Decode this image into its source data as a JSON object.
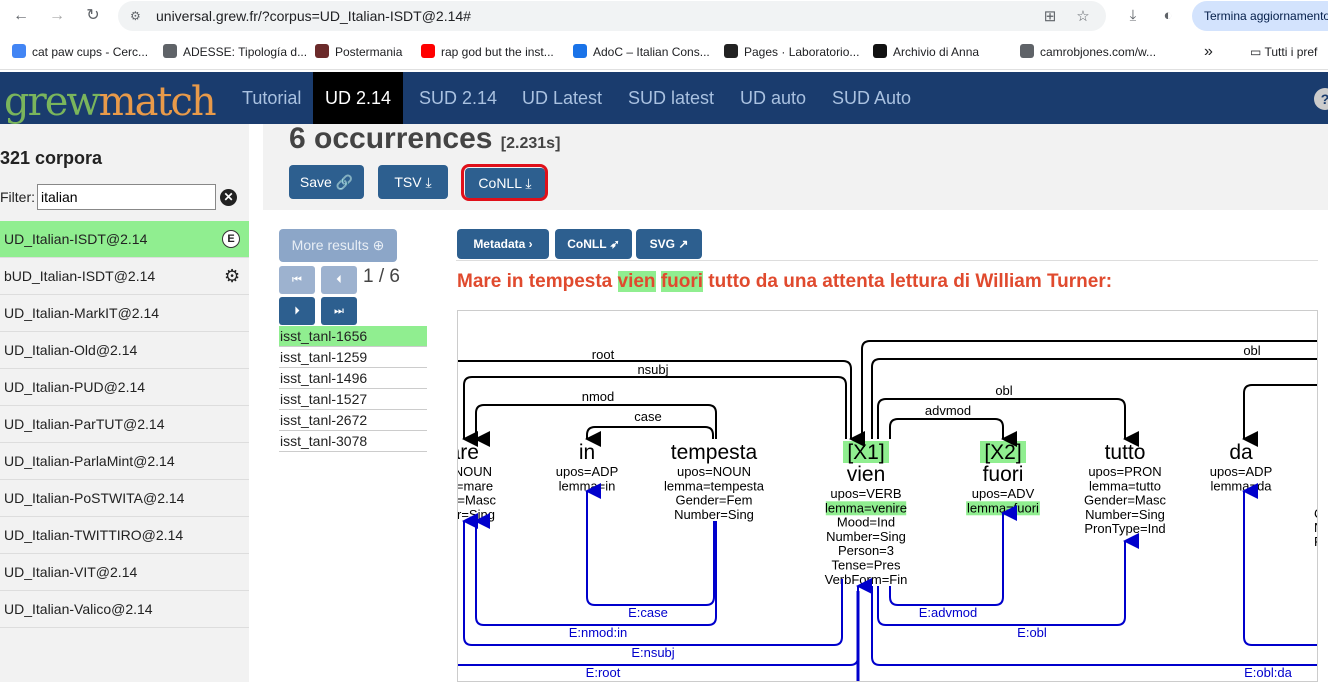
{
  "browser": {
    "url": "universal.grew.fr/?corpus=UD_Italian-ISDT@2.14#",
    "update_button": "Termina aggiornamento",
    "bookmarks": [
      {
        "label": "cat paw cups - Cerc...",
        "icon": "google-icon",
        "color": "#4285f4"
      },
      {
        "label": "ADESSE: Tipología d...",
        "icon": "globe-icon",
        "color": "#5f6368"
      },
      {
        "label": "Postermania",
        "icon": "postermania-icon",
        "color": "#6b2a2a"
      },
      {
        "label": "rap god but the inst...",
        "icon": "youtube-icon",
        "color": "#ff0000"
      },
      {
        "label": "AdoC – Italian Cons...",
        "icon": "cloud-icon",
        "color": "#1a73e8"
      },
      {
        "label": "Pages · Laboratorio...",
        "icon": "github-icon",
        "color": "#222222"
      },
      {
        "label": "Archivio di Anna",
        "icon": "letter-a-icon",
        "color": "#111111"
      },
      {
        "label": "camrobjones.com/w...",
        "icon": "globe-icon",
        "color": "#5f6368"
      }
    ],
    "more_bookmarks": "»",
    "all_bookmarks": "Tutti i pref"
  },
  "app": {
    "logo": {
      "part1": "grew",
      "part2": "match"
    },
    "nav_tabs": [
      "Tutorial",
      "UD 2.14",
      "SUD 2.14",
      "UD Latest",
      "SUD latest",
      "UD auto",
      "SUD Auto"
    ],
    "active_tab": "UD 2.14",
    "help": "?"
  },
  "sidebar": {
    "corpus_count": "321 corpora",
    "filter_label": "Filter:",
    "filter_value": "italian",
    "corpora": [
      {
        "label": "UD_Italian-ISDT@2.14",
        "selected": true,
        "badge": "E"
      },
      {
        "label": "bUD_Italian-ISDT@2.14",
        "gear": true
      },
      {
        "label": "UD_Italian-MarkIT@2.14"
      },
      {
        "label": "UD_Italian-Old@2.14"
      },
      {
        "label": "UD_Italian-PUD@2.14"
      },
      {
        "label": "UD_Italian-ParTUT@2.14"
      },
      {
        "label": "UD_Italian-ParlaMint@2.14"
      },
      {
        "label": "UD_Italian-PoSTWITA@2.14"
      },
      {
        "label": "UD_Italian-TWITTIRO@2.14"
      },
      {
        "label": "UD_Italian-VIT@2.14"
      },
      {
        "label": "UD_Italian-Valico@2.14"
      }
    ]
  },
  "results": {
    "count": "6 occurrences",
    "time": "[2.231s]",
    "save": "Save",
    "tsv": "TSV",
    "conll": "CoNLL",
    "more_results": "More results",
    "page_current": 1,
    "page_total": 6,
    "page_text": "1 / 6",
    "sentence_ids": [
      "isst_tanl-1656",
      "isst_tanl-1259",
      "isst_tanl-1496",
      "isst_tanl-1527",
      "isst_tanl-2672",
      "isst_tanl-3078"
    ],
    "selected_id": "isst_tanl-1656"
  },
  "toolbar": {
    "metadata": "Metadata",
    "conll": "CoNLL",
    "svg": "SVG"
  },
  "sentence": {
    "before": "Mare in tempesta ",
    "hl1": "vien",
    "mid": " ",
    "hl2": "fuori",
    "after": " tutto da una attenta lettura di William Turner:"
  },
  "graph": {
    "tokens": [
      {
        "form": "Mare",
        "feats": [
          "upos=NOUN",
          "lemma=mare",
          "Gender=Masc",
          "Number=Sing"
        ]
      },
      {
        "form": "in",
        "feats": [
          "upos=ADP",
          "lemma=in"
        ]
      },
      {
        "form": "tempesta",
        "feats": [
          "upos=NOUN",
          "lemma=tempesta",
          "Gender=Fem",
          "Number=Sing"
        ]
      },
      {
        "form": "vien",
        "tag": "[X1]",
        "feats": [
          "upos=VERB",
          "lemma=venire",
          "Mood=Ind",
          "Number=Sing",
          "Person=3",
          "Tense=Pres",
          "VerbForm=Fin"
        ],
        "hl_feat": "lemma=venire"
      },
      {
        "form": "fuori",
        "tag": "[X2]",
        "feats": [
          "upos=ADV",
          "lemma=fuori"
        ],
        "hl_feat": "lemma=fuori"
      },
      {
        "form": "tutto",
        "feats": [
          "upos=PRON",
          "lemma=tutto",
          "Gender=Masc",
          "Number=Sing",
          "PronType=Ind"
        ]
      },
      {
        "form": "da",
        "feats": [
          "upos=ADP",
          "lemma=da"
        ]
      }
    ],
    "upper_relations": [
      "root",
      "nsubj",
      "nmod",
      "case",
      "advmod",
      "obl",
      "obl"
    ],
    "lower_relations": [
      "E:case",
      "E:nmod:in",
      "E:nsubj",
      "E:root",
      "E:advmod",
      "E:obl",
      "E:obl:da"
    ],
    "partial_features": [
      "C",
      "N",
      "F"
    ],
    "colors": {
      "upper": "#000000",
      "lower": "#0000cc",
      "highlight": "#90ee90"
    }
  }
}
